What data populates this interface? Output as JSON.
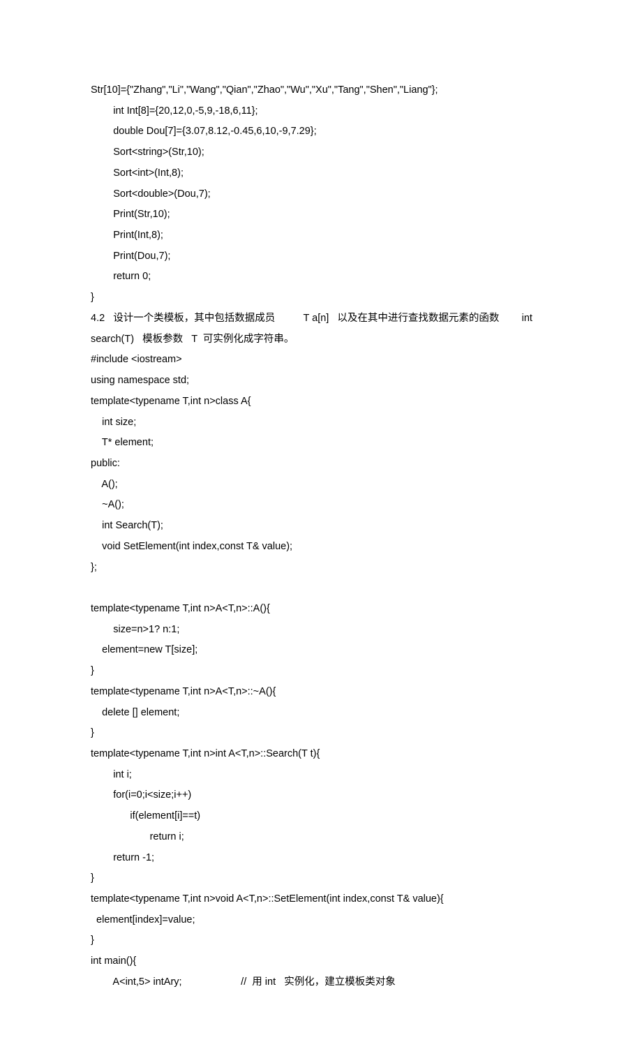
{
  "lines": [
    {
      "cls": "code-line",
      "text": "Str[10]={\"Zhang\",\"Li\",\"Wang\",\"Qian\",\"Zhao\",\"Wu\",\"Xu\",\"Tang\",\"Shen\",\"Liang\"};"
    },
    {
      "cls": "code-line",
      "text": "        int Int[8]={20,12,0,-5,9,-18,6,11};"
    },
    {
      "cls": "code-line",
      "text": "        double Dou[7]={3.07,8.12,-0.45,6,10,-9,7.29};"
    },
    {
      "cls": "code-line",
      "text": "        Sort<string>(Str,10);"
    },
    {
      "cls": "code-line",
      "text": "        Sort<int>(Int,8);"
    },
    {
      "cls": "code-line",
      "text": "        Sort<double>(Dou,7);"
    },
    {
      "cls": "code-line",
      "text": "        Print(Str,10);"
    },
    {
      "cls": "code-line",
      "text": "        Print(Int,8);"
    },
    {
      "cls": "code-line",
      "text": "        Print(Dou,7);"
    },
    {
      "cls": "code-line",
      "text": "        return 0;"
    },
    {
      "cls": "code-line",
      "text": "}"
    },
    {
      "cls": "prose-line",
      "text": "4.2   设计一个类模板，其中包括数据成员          T a[n]   以及在其中进行查找数据元素的函数        int"
    },
    {
      "cls": "prose-line",
      "text": "search(T)   模板参数   T  可实例化成字符串。"
    },
    {
      "cls": "code-line",
      "text": "#include <iostream>"
    },
    {
      "cls": "code-line",
      "text": "using namespace std;"
    },
    {
      "cls": "code-line",
      "text": "template<typename T,int n>class A{"
    },
    {
      "cls": "code-line",
      "text": "    int size;"
    },
    {
      "cls": "code-line",
      "text": "    T* element;"
    },
    {
      "cls": "code-line",
      "text": "public:"
    },
    {
      "cls": "code-line",
      "text": "    A();"
    },
    {
      "cls": "code-line",
      "text": "    ~A();"
    },
    {
      "cls": "code-line",
      "text": "    int Search(T);"
    },
    {
      "cls": "code-line",
      "text": "    void SetElement(int index,const T& value);"
    },
    {
      "cls": "code-line",
      "text": "};"
    },
    {
      "cls": "code-line",
      "text": ""
    },
    {
      "cls": "code-line",
      "text": "template<typename T,int n>A<T,n>::A(){"
    },
    {
      "cls": "code-line",
      "text": "        size=n>1? n:1;"
    },
    {
      "cls": "code-line",
      "text": "    element=new T[size];"
    },
    {
      "cls": "code-line",
      "text": "}"
    },
    {
      "cls": "code-line",
      "text": "template<typename T,int n>A<T,n>::~A(){"
    },
    {
      "cls": "code-line",
      "text": "    delete [] element;"
    },
    {
      "cls": "code-line",
      "text": "}"
    },
    {
      "cls": "code-line",
      "text": "template<typename T,int n>int A<T,n>::Search(T t){"
    },
    {
      "cls": "code-line",
      "text": "        int i;"
    },
    {
      "cls": "code-line",
      "text": "        for(i=0;i<size;i++)"
    },
    {
      "cls": "code-line",
      "text": "              if(element[i]==t)"
    },
    {
      "cls": "code-line",
      "text": "                     return i;"
    },
    {
      "cls": "code-line",
      "text": "        return -1;"
    },
    {
      "cls": "code-line",
      "text": "}"
    },
    {
      "cls": "code-line",
      "text": "template<typename T,int n>void A<T,n>::SetElement(int index,const T& value){"
    },
    {
      "cls": "code-line",
      "text": "  element[index]=value;"
    },
    {
      "cls": "code-line",
      "text": "}"
    },
    {
      "cls": "code-line",
      "text": "int main(){"
    },
    {
      "cls": "code-line",
      "text": "        A<int,5> intAry;                     //  用 int   实例化，建立模板类对象"
    }
  ]
}
